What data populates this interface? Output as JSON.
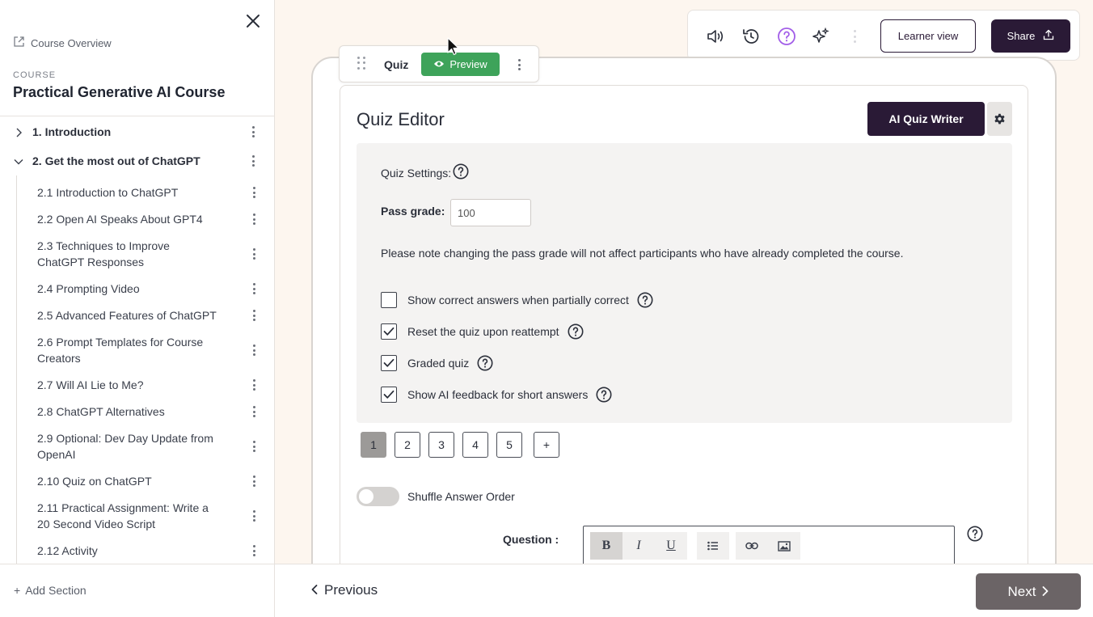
{
  "sidebar": {
    "overview_label": "Course Overview",
    "course_label": "COURSE",
    "course_title": "Practical Generative AI Course",
    "sections": [
      {
        "label": "1. Introduction",
        "expanded": false
      },
      {
        "label": "2. Get the most out of ChatGPT",
        "expanded": true
      }
    ],
    "items": [
      {
        "label": "2.1 Introduction to ChatGPT"
      },
      {
        "label": "2.2 Open AI Speaks About GPT4"
      },
      {
        "label": "2.3 Techniques to Improve ChatGPT Responses"
      },
      {
        "label": "2.4 Prompting Video"
      },
      {
        "label": "2.5 Advanced Features of ChatGPT"
      },
      {
        "label": "2.6 Prompt Templates for Course Creators"
      },
      {
        "label": "2.7 Will AI Lie to Me?"
      },
      {
        "label": "2.8 ChatGPT Alternatives"
      },
      {
        "label": "2.9 Optional: Dev Day Update from OpenAI"
      },
      {
        "label": "2.10 Quiz on ChatGPT"
      },
      {
        "label": "2.11 Practical Assignment: Write a 20 Second Video Script"
      },
      {
        "label": "2.12 Activity"
      }
    ],
    "add_section_label": "Add Section"
  },
  "toolbar": {
    "icons": [
      "audio-icon",
      "history-icon",
      "help-icon",
      "ai-sparkle-icon"
    ],
    "learner_view_label": "Learner view",
    "share_label": "Share",
    "accent_color": "#a25ee8"
  },
  "block": {
    "type_label": "Quiz",
    "preview_label": "Preview"
  },
  "editor": {
    "title": "Quiz Editor",
    "ai_button_label": "AI Quiz Writer",
    "settings_label": "Quiz Settings:",
    "pass_grade_label": "Pass grade:",
    "pass_grade_value": "100",
    "note": "Please note changing the pass grade will not affect participants who have already completed the course.",
    "options": [
      {
        "label": "Show correct answers when partially correct",
        "checked": false
      },
      {
        "label": "Reset the quiz upon reattempt",
        "checked": true
      },
      {
        "label": "Graded quiz",
        "checked": true
      },
      {
        "label": "Show AI feedback for short answers",
        "checked": true
      }
    ],
    "questions": [
      "1",
      "2",
      "3",
      "4",
      "5"
    ],
    "active_question": "1",
    "add_question_label": "+",
    "shuffle_label": "Shuffle Answer Order",
    "shuffle_on": false,
    "question_label": "Question :",
    "rte_buttons": [
      "B",
      "I",
      "U"
    ]
  },
  "footer": {
    "previous_label": "Previous",
    "next_label": "Next"
  },
  "colors": {
    "brand_dark": "#2a1a36",
    "preview_green": "#3ea35a",
    "background": "#fdf6ef"
  }
}
